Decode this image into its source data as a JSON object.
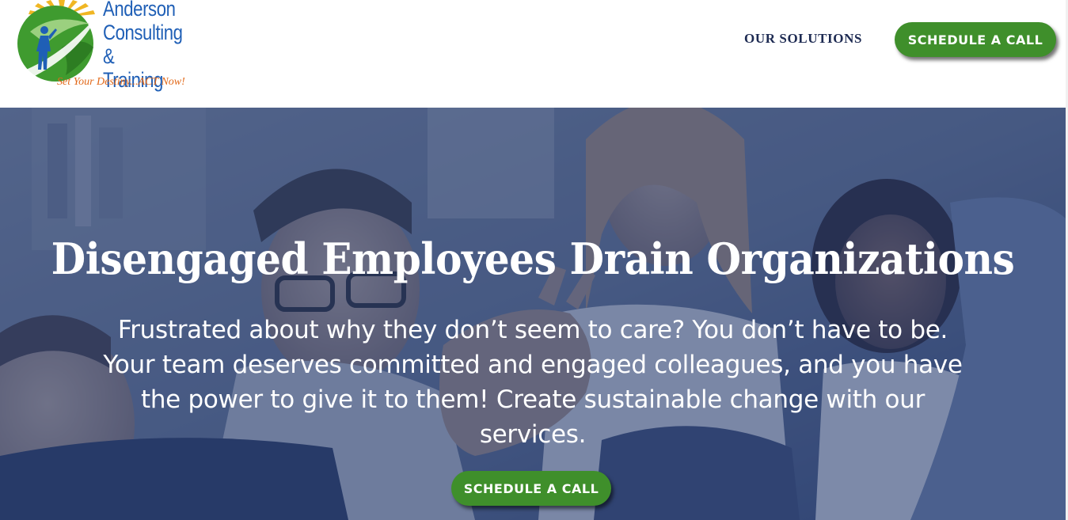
{
  "brand": {
    "name_line1": "Anderson",
    "name_line2": "Consulting &",
    "name_line3": "Training",
    "tagline": "Set Your Destiny...ACT Now!",
    "colors": {
      "name": "#1f5fb6",
      "tagline": "#e26a1b",
      "globe": "#3f9b2f"
    },
    "icons": [
      "sun-rays-icon",
      "globe-icon",
      "figure-icon"
    ]
  },
  "nav": {
    "solutions_label": "OUR SOLUTIONS",
    "cta_label": "SCHEDULE A CALL"
  },
  "hero": {
    "title": "Disengaged Employees Drain Organizations",
    "body": "Frustrated about why they don’t seem to care? You don’t have to be. Your team deserves committed and engaged colleagues, and you have the power to give it to them! Create sustainable change with our services.",
    "cta_label": "SCHEDULE A CALL"
  },
  "colors": {
    "accent_green": "#3f8f2b",
    "nav_text": "#1d2a52",
    "hero_overlay": "#243a6e"
  }
}
